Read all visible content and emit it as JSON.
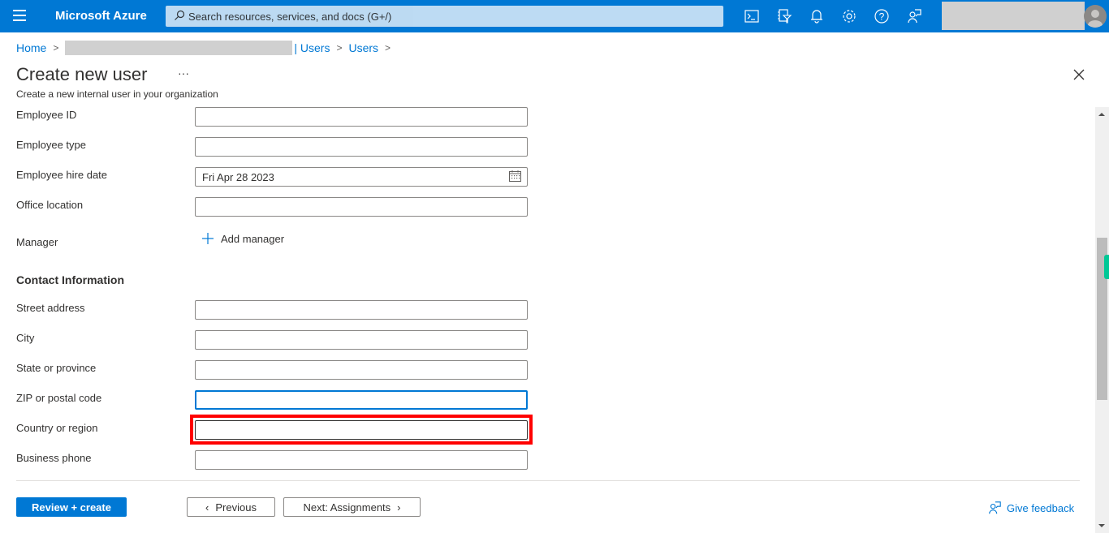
{
  "topbar": {
    "brand": "Microsoft Azure",
    "search_placeholder": "Search resources, services, and docs (G+/)",
    "icons": [
      "cloud-shell-icon",
      "directory-filter-icon",
      "notifications-icon",
      "settings-icon",
      "help-icon",
      "feedback-icon"
    ]
  },
  "breadcrumb": {
    "home": "Home",
    "users1": "| Users",
    "users2": "Users"
  },
  "page": {
    "title": "Create new user",
    "ellipsis": "···",
    "subtitle": "Create a new internal user in your organization"
  },
  "form": {
    "employee_id": {
      "label": "Employee ID",
      "value": ""
    },
    "employee_type": {
      "label": "Employee type",
      "value": ""
    },
    "hire_date": {
      "label": "Employee hire date",
      "value": "Fri Apr 28 2023"
    },
    "office_location": {
      "label": "Office location",
      "value": ""
    },
    "manager": {
      "label": "Manager",
      "action": "Add manager"
    },
    "contact_section": "Contact Information",
    "street": {
      "label": "Street address",
      "value": ""
    },
    "city": {
      "label": "City",
      "value": ""
    },
    "state": {
      "label": "State or province",
      "value": ""
    },
    "zip": {
      "label": "ZIP or postal code",
      "value": ""
    },
    "country": {
      "label": "Country or region",
      "value": ""
    },
    "business_phone": {
      "label": "Business phone",
      "value": ""
    }
  },
  "footer": {
    "review_create": "Review + create",
    "previous": "Previous",
    "next": "Next: Assignments",
    "feedback": "Give feedback"
  },
  "colors": {
    "accent": "#0078d4",
    "highlight": "#ff0000"
  }
}
